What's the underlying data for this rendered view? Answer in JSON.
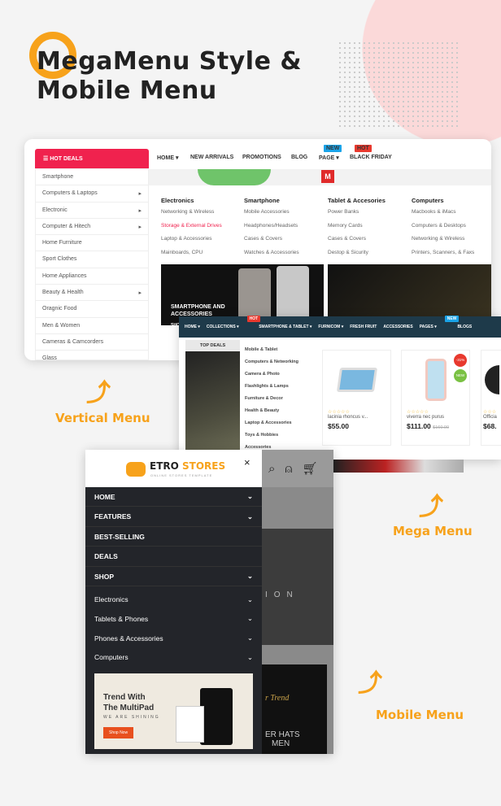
{
  "title": {
    "line1": "MegaMenu Style &",
    "line2": "Mobile Menu"
  },
  "labels": {
    "vertical": "Vertical Menu",
    "mega": "Mega Menu",
    "mobile": "Mobile Menu"
  },
  "colors": {
    "accent": "#f7a21b",
    "hot": "#f0224e",
    "nav_dark": "#1e3a4a",
    "drawer": "#23252a"
  },
  "vertical": {
    "header": "HOT DEALS",
    "items": [
      {
        "label": "Smartphone",
        "sub": false
      },
      {
        "label": "Computers & Laptops",
        "sub": true
      },
      {
        "label": "Electronic",
        "sub": true
      },
      {
        "label": "Computer & Hitech",
        "sub": true
      },
      {
        "label": "Home Furniture",
        "sub": false
      },
      {
        "label": "Sport Clothes",
        "sub": false
      },
      {
        "label": "Home Appliances",
        "sub": false
      },
      {
        "label": "Beauty & Health",
        "sub": true
      },
      {
        "label": "Oragnic Food",
        "sub": false
      },
      {
        "label": "Men & Women",
        "sub": false
      },
      {
        "label": "Cameras & Camcorders",
        "sub": false
      },
      {
        "label": "Glass",
        "sub": false
      }
    ]
  },
  "nav1": [
    {
      "label": "HOME ▾"
    },
    {
      "label": "NEW ARRIVALS"
    },
    {
      "label": "PROMOTIONS"
    },
    {
      "label": "BLOG"
    },
    {
      "label": "PAGE ▾",
      "badge": "NEW",
      "badge_color": "#1aa3e8"
    },
    {
      "label": "BLACK FRIDAY",
      "badge": "HOT",
      "badge_color": "#e8392e"
    }
  ],
  "mega": [
    {
      "heading": "Electronics",
      "items": [
        "Networking & Wireless",
        "Storage & External Drives",
        "Laptop & Accessories",
        "Mainboards, CPU"
      ]
    },
    {
      "heading": "Smartphone",
      "items": [
        "Mobile Accessories",
        "Headphones/Headsets",
        "Cases & Covers",
        "Watches & Accessories"
      ]
    },
    {
      "heading": "Tablet & Accesories",
      "items": [
        "Power Banks",
        "Memory Cards",
        "Cases & Covers",
        "Destop & Sicurity"
      ]
    },
    {
      "heading": "Computers",
      "items": [
        "Macbooks & iMacs",
        "Computers & Desktops",
        "Networking & Wireless",
        "Printers, Scanners, & Faxs"
      ]
    }
  ],
  "mega_highlight": "Storage & External Drives",
  "banner1": {
    "line1": "SMARTPHONE AND",
    "line2": "ACCESSORIES",
    "cta": "SHO"
  },
  "logo_letter": "M",
  "nav2": [
    {
      "label": "HOME ▾"
    },
    {
      "label": "COLLECTIONS ▾",
      "badge": "HOT",
      "badge_color": "#e8392e"
    },
    {
      "label": "SMARTPHONE & TABLET ▾"
    },
    {
      "label": "FURNICOM ▾",
      "active": true
    },
    {
      "label": "FRESH FRUIT"
    },
    {
      "label": "ACCESSORIES"
    },
    {
      "label": "PAGES ▾",
      "badge": "NEW",
      "badge_color": "#1aa3e8"
    },
    {
      "label": "BLOGS"
    }
  ],
  "top_deals": "TOP DEALS",
  "cats2": [
    "Mobile & Tablet",
    "Computers & Networking",
    "Camera & Photo",
    "Flashlights & Lamps",
    "Furniture & Decor",
    "Health & Beauty",
    "Laptop & Accessories",
    "Toys & Hobbies",
    "Accessories"
  ],
  "products": [
    {
      "name": "lacinia rhoncus v...",
      "price": "$55.00",
      "stars": "☆☆☆☆☆",
      "icon": "tablet"
    },
    {
      "name": "viverra nec purus",
      "price": "$111.00",
      "old": "$160.00",
      "stars": "☆☆☆☆☆",
      "sale": "-31%",
      "new": "NEW",
      "icon": "phone"
    },
    {
      "name": "Officia",
      "price": "$68.",
      "stars": "☆☆☆",
      "icon": "watch"
    }
  ],
  "mobile": {
    "brand1": "ETRO",
    "brand2": "STORES",
    "tagline": "ONLINE STORES TEMPLATE",
    "close": "×",
    "menu": [
      {
        "label": "HOME",
        "chev": true
      },
      {
        "label": "FEATURES",
        "chev": true
      },
      {
        "label": "BEST-SELLING",
        "chev": false
      },
      {
        "label": "DEALS",
        "chev": false
      },
      {
        "label": "SHOP",
        "chev": true
      }
    ],
    "cats": [
      "Electronics",
      "Tablets & Phones",
      "Phones & Accessories",
      "Computers"
    ],
    "promo": {
      "line1": "Trend With",
      "line2": "The MultiPad",
      "sub": "WE ARE SHINING",
      "cta": "Shop Now"
    },
    "bg_text": {
      "word": "ION",
      "script": "r Trend",
      "hats1": "ER HATS",
      "hats2": "MEN"
    }
  }
}
